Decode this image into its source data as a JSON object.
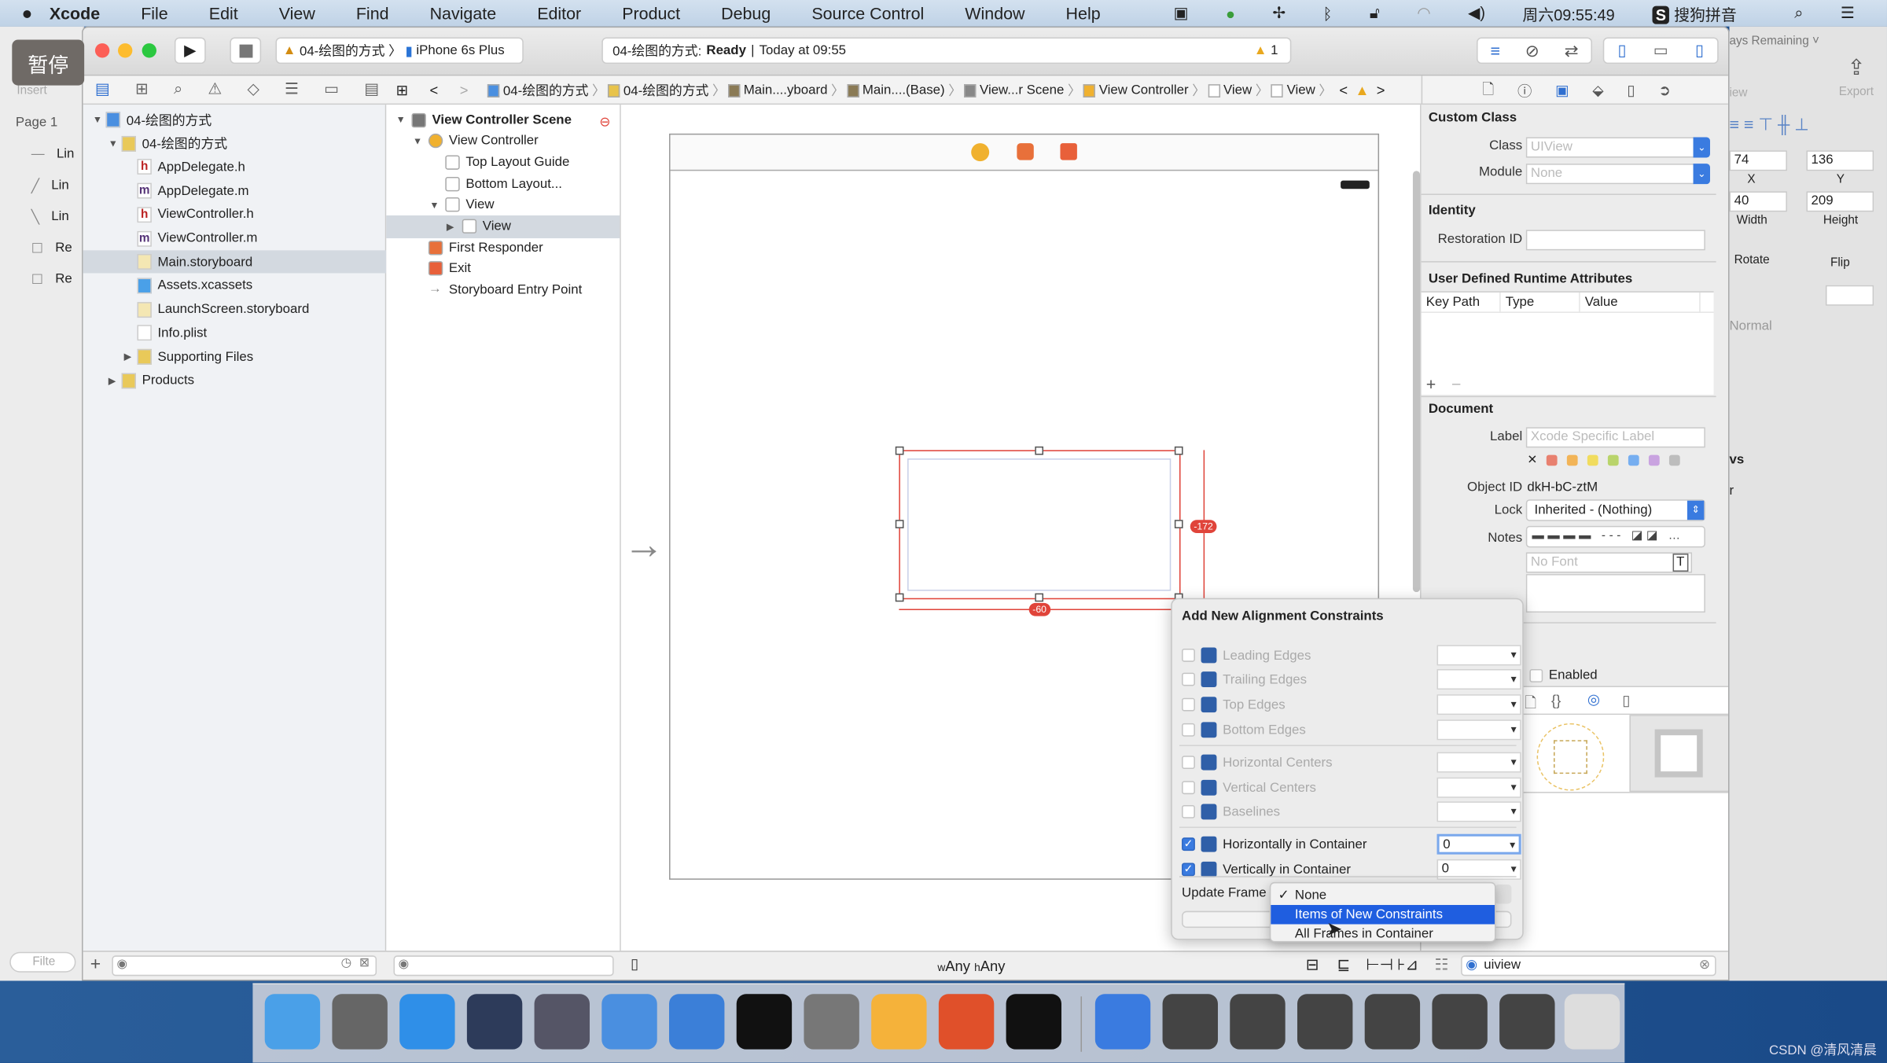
{
  "menubar": {
    "app": "Xcode",
    "items": [
      "File",
      "Edit",
      "View",
      "Find",
      "Navigate",
      "Editor",
      "Product",
      "Debug",
      "Source Control",
      "Window",
      "Help"
    ],
    "clock": "周六09:55:49",
    "ime": "搜狗拼音"
  },
  "overlay": {
    "pause": "暂停"
  },
  "sketch_left": {
    "insert": "Insert",
    "page": "Page 1",
    "items": [
      "Lin",
      "Lin",
      "Lin",
      "Re",
      "Re"
    ],
    "filter": "Filte"
  },
  "sketch_right": {
    "trial": "ays Remaining",
    "view": "iew",
    "export": "Export",
    "x": "74",
    "y": "136",
    "x_label": "X",
    "y_label": "Y",
    "width": "40",
    "height": "209",
    "width_label": "Width",
    "height_label": "Height",
    "rotate": "Rotate",
    "flip": "Flip",
    "blend": "Normal",
    "section": "vs",
    "sub": "r"
  },
  "toolbar": {
    "scheme": "04-绘图的方式",
    "device": "iPhone 6s Plus",
    "status_project": "04-绘图的方式:",
    "status": "Ready",
    "status_time": "Today at 09:55",
    "warnings": "1"
  },
  "jumpbar": [
    "04-绘图的方式",
    "04-绘图的方式",
    "Main....yboard",
    "Main....(Base)",
    "View...r Scene",
    "View Controller",
    "View",
    "View"
  ],
  "navigator": {
    "items": [
      {
        "label": "04-绘图的方式",
        "level": 0,
        "icon": "project-icon",
        "disclosure": "open"
      },
      {
        "label": "04-绘图的方式",
        "level": 1,
        "icon": "folder-icon",
        "disclosure": "open"
      },
      {
        "label": "AppDelegate.h",
        "level": 2,
        "icon": "header-file-icon"
      },
      {
        "label": "AppDelegate.m",
        "level": 2,
        "icon": "implementation-file-icon"
      },
      {
        "label": "ViewController.h",
        "level": 2,
        "icon": "header-file-icon"
      },
      {
        "label": "ViewController.m",
        "level": 2,
        "icon": "implementation-file-icon"
      },
      {
        "label": "Main.storyboard",
        "level": 2,
        "icon": "storyboard-icon",
        "selected": true
      },
      {
        "label": "Assets.xcassets",
        "level": 2,
        "icon": "assets-icon"
      },
      {
        "label": "LaunchScreen.storyboard",
        "level": 2,
        "icon": "storyboard-icon"
      },
      {
        "label": "Info.plist",
        "level": 2,
        "icon": "plist-icon"
      },
      {
        "label": "Supporting Files",
        "level": 2,
        "icon": "folder-icon",
        "disclosure": "closed"
      },
      {
        "label": "Products",
        "level": 1,
        "icon": "folder-icon",
        "disclosure": "closed"
      }
    ]
  },
  "outline": {
    "items": [
      {
        "label": "View Controller Scene",
        "level": 0,
        "bold": true,
        "disclosure": "open",
        "icon": "scene-icon"
      },
      {
        "label": "View Controller",
        "level": 1,
        "disclosure": "open",
        "icon": "view-controller-icon"
      },
      {
        "label": "Top Layout Guide",
        "level": 2,
        "icon": "layout-guide-icon"
      },
      {
        "label": "Bottom Layout...",
        "level": 2,
        "icon": "layout-guide-icon"
      },
      {
        "label": "View",
        "level": 2,
        "disclosure": "open",
        "icon": "view-icon"
      },
      {
        "label": "View",
        "level": 3,
        "disclosure": "closed",
        "icon": "view-icon",
        "selected": true
      },
      {
        "label": "First Responder",
        "level": 1,
        "icon": "first-responder-icon"
      },
      {
        "label": "Exit",
        "level": 1,
        "icon": "exit-icon"
      },
      {
        "label": "Storyboard Entry Point",
        "level": 1,
        "icon": "arrow-icon"
      }
    ]
  },
  "canvas": {
    "constraint_right": "-172",
    "constraint_bottom": "-60",
    "size_class_w": "w",
    "size_class_w_val": "Any",
    "size_class_h": "h",
    "size_class_h_val": "Any"
  },
  "popover": {
    "title": "Add New Alignment Constraints",
    "rows": [
      {
        "label": "Leading Edges",
        "checked": false,
        "value": ""
      },
      {
        "label": "Trailing Edges",
        "checked": false,
        "value": ""
      },
      {
        "label": "Top Edges",
        "checked": false,
        "value": ""
      },
      {
        "label": "Bottom Edges",
        "checked": false,
        "value": ""
      },
      {
        "label": "Horizontal Centers",
        "checked": false,
        "value": ""
      },
      {
        "label": "Vertical Centers",
        "checked": false,
        "value": ""
      },
      {
        "label": "Baselines",
        "checked": false,
        "value": ""
      },
      {
        "label": "Horizontally in Container",
        "checked": true,
        "value": "0"
      },
      {
        "label": "Vertically in Container",
        "checked": true,
        "value": "0"
      }
    ],
    "update_frames_label": "Update Frame",
    "menu": [
      {
        "label": "None",
        "checked": true
      },
      {
        "label": "Items of New Constraints",
        "highlighted": true
      },
      {
        "label": "All Frames in Container"
      }
    ]
  },
  "inspector": {
    "custom_class": "Custom Class",
    "class_label": "Class",
    "class_placeholder": "UIView",
    "module_label": "Module",
    "module_placeholder": "None",
    "identity": "Identity",
    "restoration_label": "Restoration ID",
    "restoration_value": "",
    "runtime": "User Defined Runtime Attributes",
    "columns": [
      "Key Path",
      "Type",
      "Value"
    ],
    "document": "Document",
    "label_label": "Label",
    "label_placeholder": "Xcode Specific Label",
    "label_colors": [
      "#e8806f",
      "#f2b457",
      "#f1dc5e",
      "#b9d46b",
      "#76aef0",
      "#c9a3e0",
      "#bdbdbd"
    ],
    "object_id_label": "Object ID",
    "object_id": "dkH-bC-ztM",
    "lock_label": "Lock",
    "lock_value": "Inherited - (Nothing)",
    "notes_label": "Notes",
    "font_placeholder": "No Font",
    "enabled": "Enabled",
    "filter_value": "uiview"
  },
  "watermark": "CSDN @清风清晨",
  "dock": [
    "Finder",
    "Launchpad",
    "Safari",
    "Mouse",
    "Photo Slideshow",
    "Xcode",
    "Instruments",
    "Terminal",
    "System Preferences",
    "Sketch",
    "PowerPoint",
    "Exec",
    "Preview",
    "Screenshot 1",
    "Screenshot 2",
    "Screenshot 3",
    "Screenshot 4",
    "Screenshot 5",
    "Screenshot 6",
    "Trash"
  ],
  "colors": {
    "accent": "#3a7be0",
    "constraint": "#e0443a",
    "selection": "#d3d9e0"
  }
}
